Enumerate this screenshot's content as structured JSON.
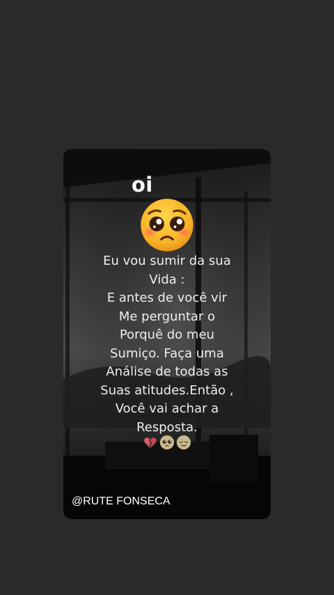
{
  "card": {
    "greeting": "oi",
    "message_lines": [
      "Eu vou sumir da sua",
      "Vida :",
      "E antes de você vir",
      "Me perguntar o",
      "Porquê do meu",
      "Sumiço. Faça uma",
      "Análise de todas as",
      "Suas atitudes.Então ,",
      "Você vai achar a",
      "Resposta."
    ],
    "handle": "@RUTE FONSECA"
  },
  "icons": {
    "large": "pleading-face-icon",
    "row": [
      "broken-heart-icon",
      "pleading-face-icon",
      "relieved-face-icon"
    ]
  },
  "colors": {
    "page_background": "#2b2a2a",
    "card_background": "#0c0c0c",
    "text": "#eeeeee"
  }
}
